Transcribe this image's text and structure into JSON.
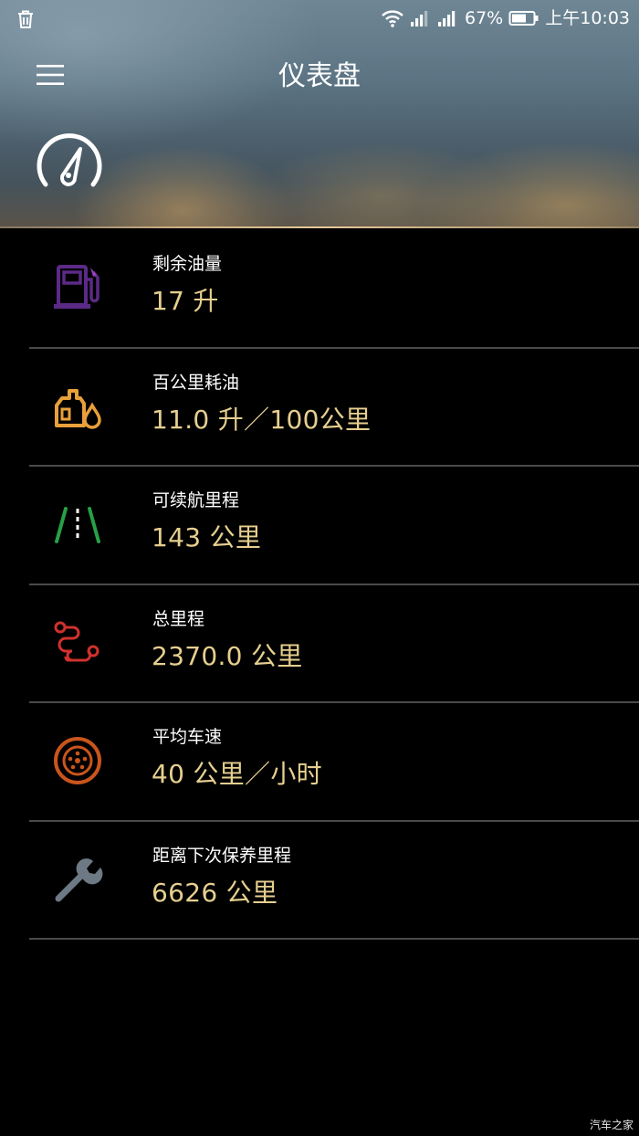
{
  "status_bar": {
    "battery_percent": "67%",
    "time": "上午10:03"
  },
  "header": {
    "title": "仪表盘"
  },
  "metrics": [
    {
      "label": "剩余油量",
      "value": "17 升",
      "icon": "fuel-pump-icon",
      "color": "#5b2a86"
    },
    {
      "label": "百公里耗油",
      "value": "11.0 升／100公里",
      "icon": "oil-can-icon",
      "color": "#e8a03a"
    },
    {
      "label": "可续航里程",
      "value": "143 公里",
      "icon": "road-icon",
      "color": "#27a046"
    },
    {
      "label": "总里程",
      "value": "2370.0 公里",
      "icon": "route-icon",
      "color": "#d0312d"
    },
    {
      "label": "平均车速",
      "value": "40 公里／小时",
      "icon": "tire-icon",
      "color": "#c9551c"
    },
    {
      "label": "距离下次保养里程",
      "value": "6626 公里",
      "icon": "wrench-icon",
      "color": "#6d7a86"
    }
  ],
  "watermark": "汽车之家",
  "colors": {
    "value_text": "#e6cf8f",
    "divider": "#4a4a4a",
    "background": "#000000"
  }
}
